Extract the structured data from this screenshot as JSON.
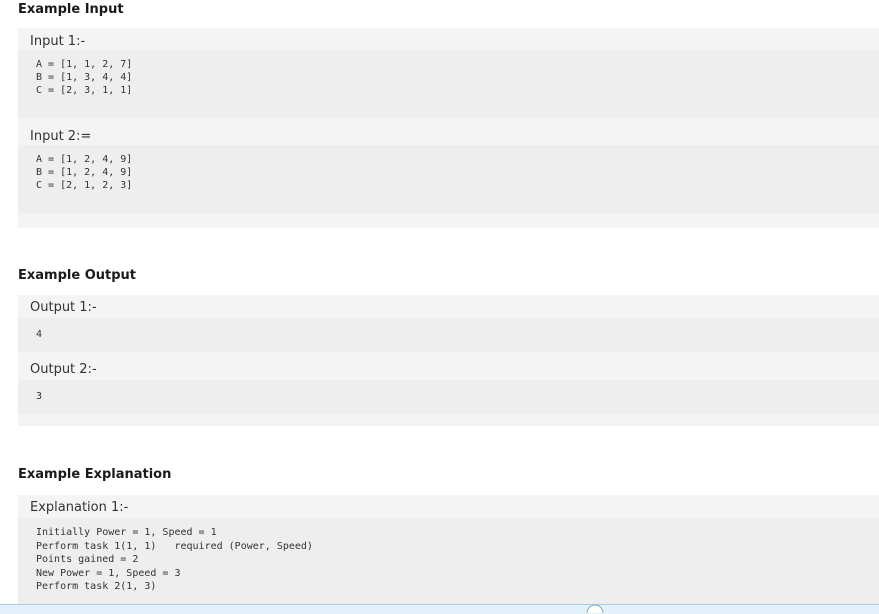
{
  "example_input": {
    "title": "Example Input",
    "inputs": [
      {
        "label": "Input 1:-",
        "lines": [
          "A = [1, 1, 2, 7]",
          "B = [1, 3, 4, 4]",
          "C = [2, 3, 1, 1]"
        ]
      },
      {
        "label": "Input 2:=",
        "lines": [
          "A = [1, 2, 4, 9]",
          "B = [1, 2, 4, 9]",
          "C = [2, 1, 2, 3]"
        ]
      }
    ]
  },
  "example_output": {
    "title": "Example Output",
    "outputs": [
      {
        "label": "Output 1:-",
        "value": "4"
      },
      {
        "label": "Output 2:-",
        "value": "3"
      }
    ]
  },
  "example_explanation": {
    "title": "Example Explanation",
    "label": "Explanation 1:-",
    "lines": [
      "Initially Power = 1, Speed = 1",
      "Perform task 1(1, 1)   required (Power, Speed)",
      "Points gained = 2",
      "New Power = 1, Speed = 3",
      "Perform task 2(1, 3)"
    ]
  },
  "colors": {
    "panel_bg": "#f4f4f4",
    "code_bg": "#eeeeee",
    "bottom_bar": "#e3f1fa"
  }
}
